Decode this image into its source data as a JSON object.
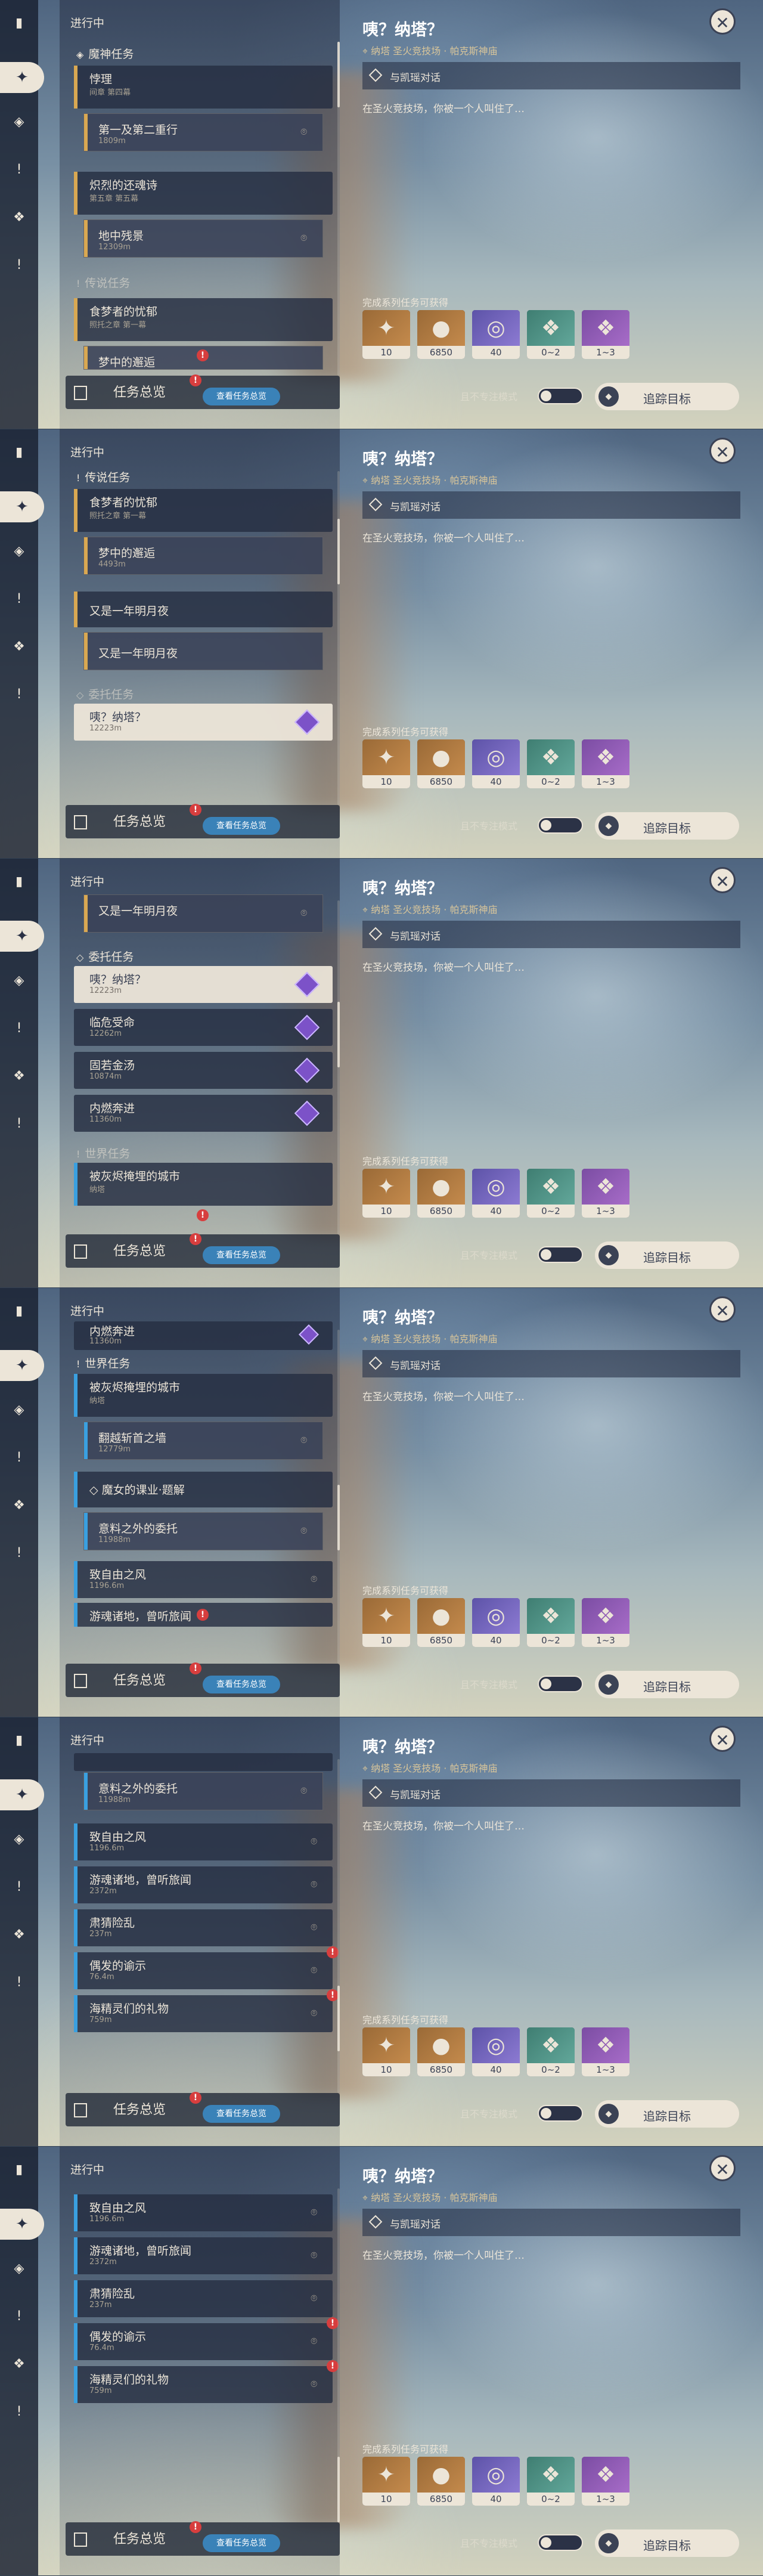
{
  "panel": {
    "title": "进行中",
    "overview_label": "任务总览",
    "overview_button": "查看任务总览",
    "badge": "!"
  },
  "groups": {
    "archon": "魔神任务",
    "legend": "传说任务",
    "commission": "委托任务",
    "world": "世界任务",
    "witch": "魔女的课业·题解"
  },
  "quests": {
    "q1": {
      "title": "悖理",
      "sub": "间章 第四幕"
    },
    "q1a": {
      "title": "第一及第二重行",
      "dist": "1809m"
    },
    "q2": {
      "title": "炽烈的还魂诗",
      "sub": "第五章 第五幕"
    },
    "q2a": {
      "title": "地中残景",
      "dist": "12309m"
    },
    "q3": {
      "title": "食梦者的忧郁",
      "sub": "照托之章 第一幕"
    },
    "q3a": {
      "title": "梦中的邂逅",
      "dist": "4493m"
    },
    "q4": {
      "title": "又是一年明月夜"
    },
    "q4a": {
      "title": "又是一年明月夜"
    },
    "c1": {
      "title": "咦？纳塔？",
      "dist": "12223m"
    },
    "c2": {
      "title": "临危受命",
      "dist": "12262m"
    },
    "c3": {
      "title": "固若金汤",
      "dist": "10874m"
    },
    "c4": {
      "title": "内燃奔进",
      "dist": "11360m"
    },
    "w1": {
      "title": "被灰烬掩埋的城市",
      "sub": "纳塔"
    },
    "w1a": {
      "title": "翻越斩首之墙",
      "dist": "12779m"
    },
    "w2a": {
      "title": "意料之外的委托",
      "dist": "11988m"
    },
    "w3": {
      "title": "致自由之风",
      "dist": "1196.6m"
    },
    "w4": {
      "title": "游魂诸地，曾听旅闻",
      "dist": "2372m"
    },
    "w5": {
      "title": "肃猜险乱",
      "dist": "237m"
    },
    "w6": {
      "title": "偶发的谕示",
      "dist": "76.4m"
    },
    "w7": {
      "title": "海精灵们的礼物",
      "dist": "759m"
    }
  },
  "detail": {
    "title": "咦？纳塔？",
    "location": "纳塔 圣火竞技场 · 帕克斯神庙",
    "objective": "与凯瑶对话",
    "description": "在圣火竞技场，你被一个人叫住了…",
    "reward_label": "完成系列任务可获得",
    "rewards": [
      {
        "icon": "primogem-icon",
        "count": "10"
      },
      {
        "icon": "mora-icon",
        "count": "6850"
      },
      {
        "icon": "adventure-exp-icon",
        "count": "40"
      },
      {
        "icon": "jade-crystal-icon",
        "count": "0~2"
      },
      {
        "icon": "pink-crystal-icon",
        "count": "1~3"
      }
    ],
    "track_toggle_label": "且不专注模式",
    "track_button": "追踪目标"
  },
  "colors": {
    "gold": "#d9a852",
    "blue": "#3aa0e0",
    "cream": "#ece5d8",
    "navy": "#3b4255",
    "purple": "#7c52c8"
  }
}
